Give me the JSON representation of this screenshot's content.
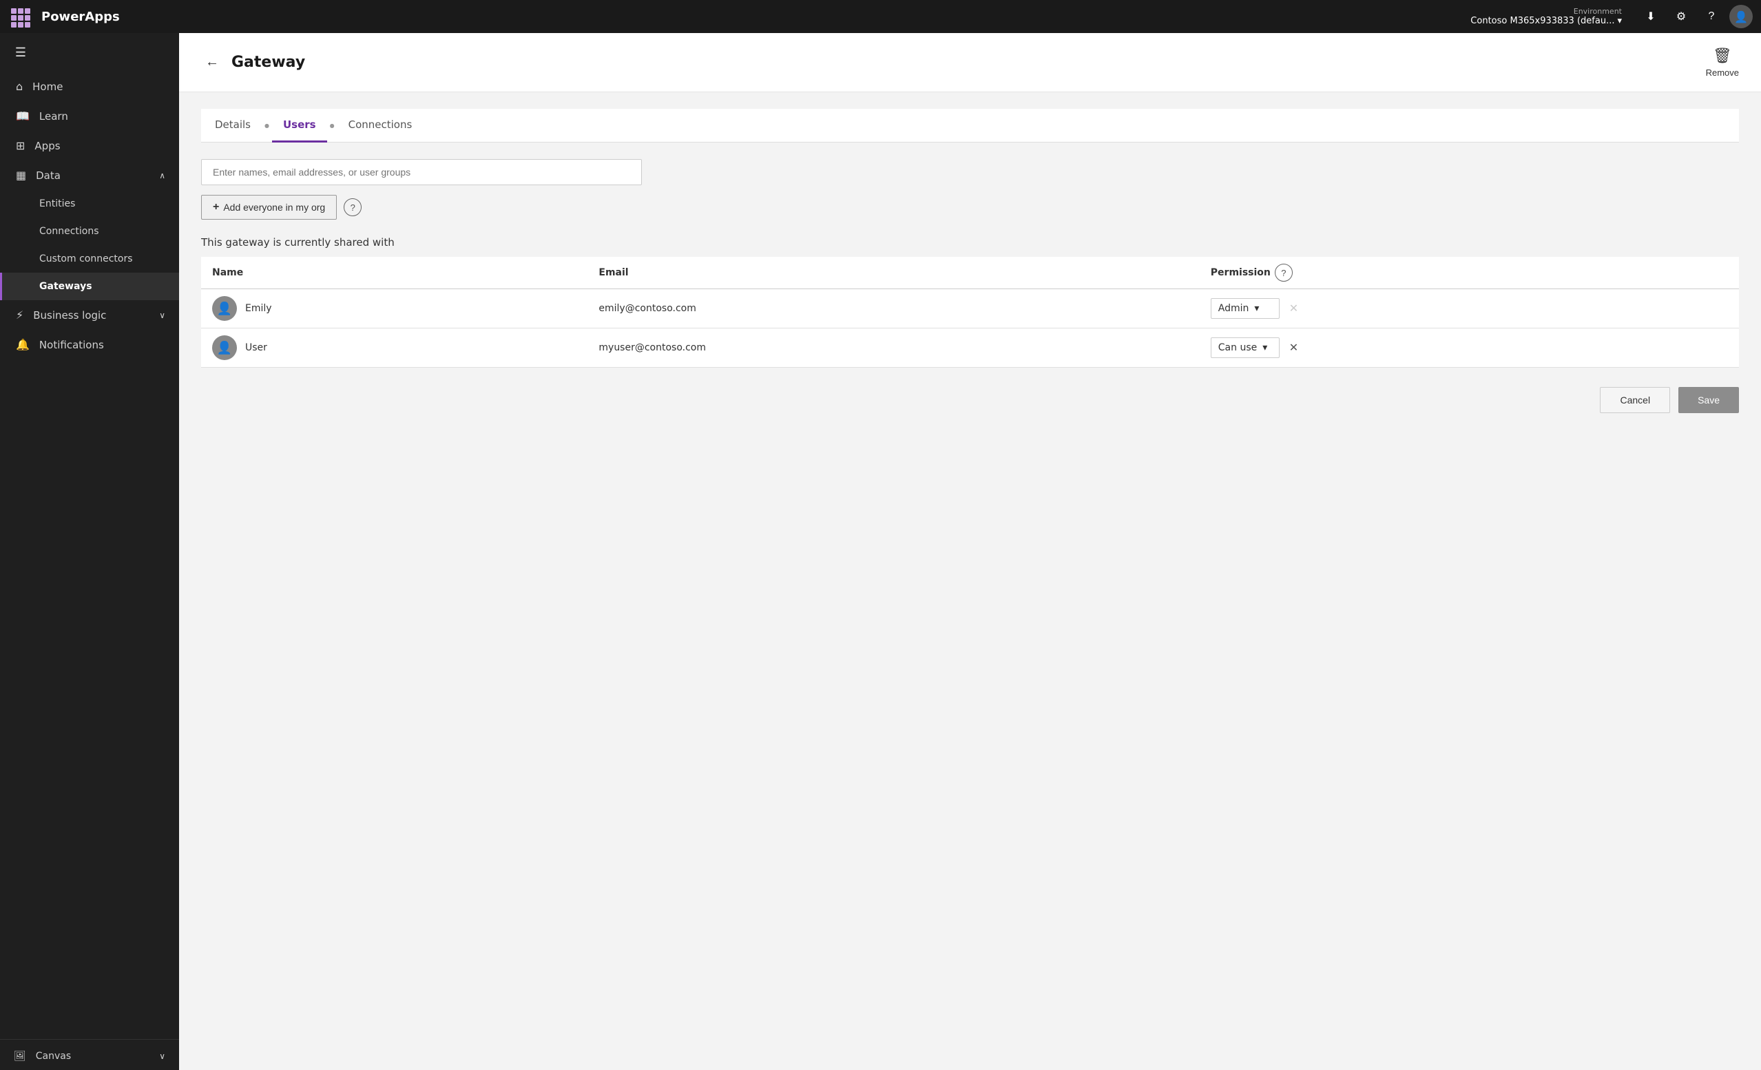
{
  "topbar": {
    "logo": "PowerApps",
    "env_label": "Environment",
    "env_value": "Contoso M365x933833 (defau...",
    "icons": {
      "download": "⬇",
      "settings": "⚙",
      "help": "?",
      "avatar": "👤"
    }
  },
  "sidebar": {
    "items": [
      {
        "id": "home",
        "label": "Home",
        "icon": "⌂"
      },
      {
        "id": "learn",
        "label": "Learn",
        "icon": "📖"
      },
      {
        "id": "apps",
        "label": "Apps",
        "icon": "⊞"
      },
      {
        "id": "data",
        "label": "Data",
        "icon": "▦",
        "expandable": true,
        "expanded": true
      },
      {
        "id": "entities",
        "label": "Entities",
        "sub": true
      },
      {
        "id": "connections",
        "label": "Connections",
        "sub": true
      },
      {
        "id": "custom-connectors",
        "label": "Custom connectors",
        "sub": true
      },
      {
        "id": "gateways",
        "label": "Gateways",
        "sub": true,
        "active": true
      },
      {
        "id": "business-logic",
        "label": "Business logic",
        "icon": "⚡",
        "expandable": true
      },
      {
        "id": "notifications",
        "label": "Notifications",
        "icon": "🔔"
      }
    ],
    "bottom": {
      "canvas_label": "Canvas"
    }
  },
  "page": {
    "title": "Gateway",
    "remove_label": "Remove",
    "tabs": [
      {
        "id": "details",
        "label": "Details",
        "active": false
      },
      {
        "id": "users",
        "label": "Users",
        "active": true
      },
      {
        "id": "connections",
        "label": "Connections",
        "active": false
      }
    ],
    "users": {
      "search_placeholder": "Enter names, email addresses, or user groups",
      "add_everyone_label": "Add everyone in my org",
      "shared_with_label": "This gateway is currently shared with",
      "table": {
        "col_name": "Name",
        "col_email": "Email",
        "col_permission": "Permission",
        "rows": [
          {
            "name": "Emily",
            "email": "emily@contoso.com",
            "permission": "Admin",
            "removable": false
          },
          {
            "name": "User",
            "email": "myuser@contoso.com",
            "permission": "Can use",
            "removable": true
          }
        ]
      },
      "cancel_label": "Cancel",
      "save_label": "Save"
    }
  }
}
